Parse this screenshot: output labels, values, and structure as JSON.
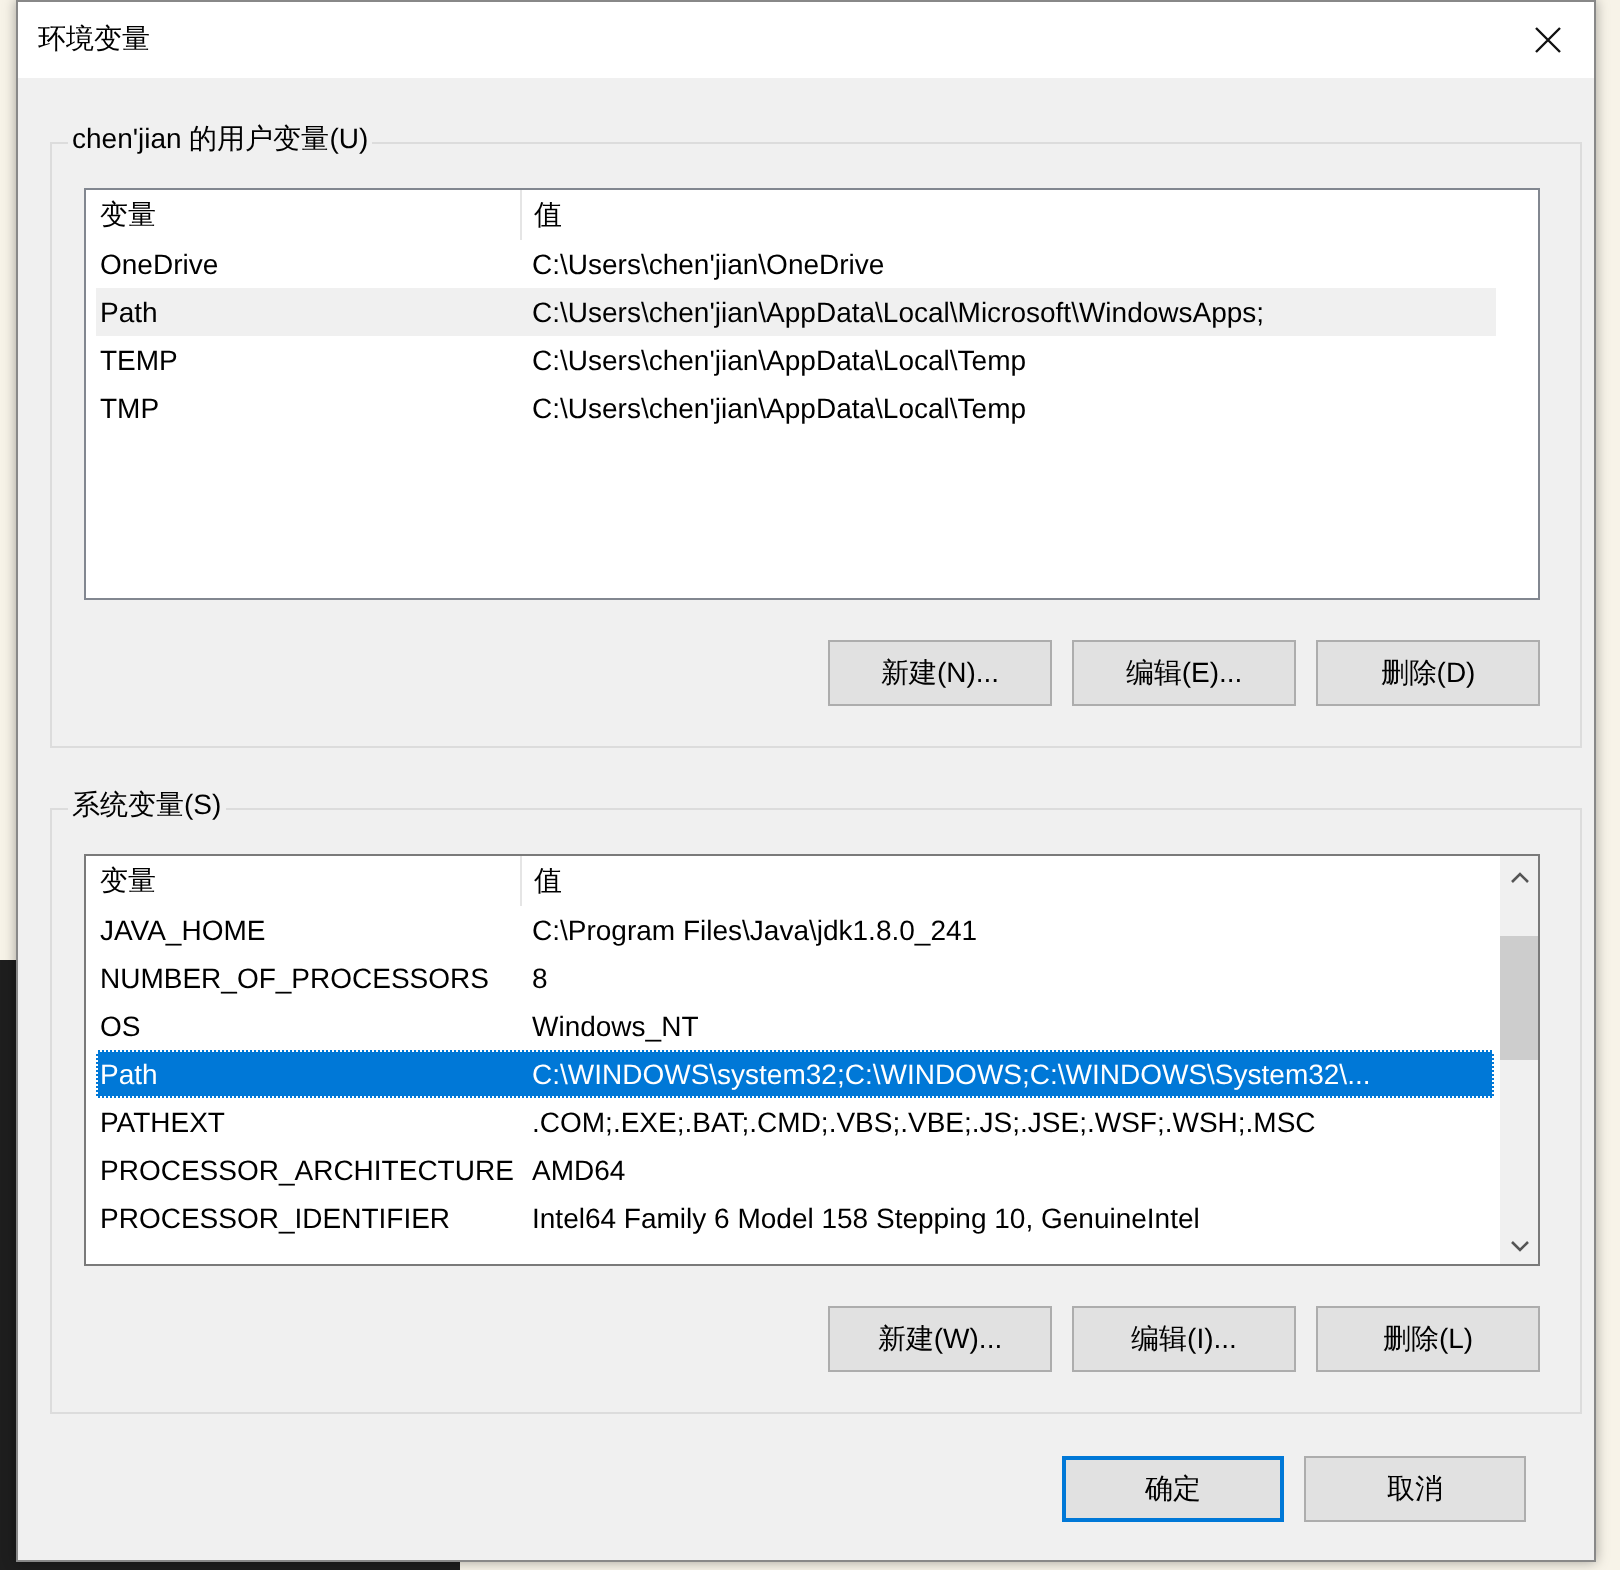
{
  "window": {
    "title": "环境变量"
  },
  "groups": [
    {
      "label": "chen'jian 的用户变量(U)",
      "focused": false,
      "scrollbar": false,
      "columns": [
        "变量",
        "值"
      ],
      "rows": [
        {
          "name": "OneDrive",
          "value": "C:\\Users\\chen'jian\\OneDrive",
          "selected": false
        },
        {
          "name": "Path",
          "value": "C:\\Users\\chen'jian\\AppData\\Local\\Microsoft\\WindowsApps;",
          "selected": true
        },
        {
          "name": "TEMP",
          "value": "C:\\Users\\chen'jian\\AppData\\Local\\Temp",
          "selected": false
        },
        {
          "name": "TMP",
          "value": "C:\\Users\\chen'jian\\AppData\\Local\\Temp",
          "selected": false
        }
      ],
      "buttons": [
        "新建(N)...",
        "编辑(E)...",
        "删除(D)"
      ]
    },
    {
      "label": "系统变量(S)",
      "focused": true,
      "scrollbar": true,
      "columns": [
        "变量",
        "值"
      ],
      "rows": [
        {
          "name": "JAVA_HOME",
          "value": "C:\\Program Files\\Java\\jdk1.8.0_241",
          "selected": false
        },
        {
          "name": "NUMBER_OF_PROCESSORS",
          "value": "8",
          "selected": false
        },
        {
          "name": "OS",
          "value": "Windows_NT",
          "selected": false
        },
        {
          "name": "Path",
          "value": "C:\\WINDOWS\\system32;C:\\WINDOWS;C:\\WINDOWS\\System32\\...",
          "selected": true
        },
        {
          "name": "PATHEXT",
          "value": ".COM;.EXE;.BAT;.CMD;.VBS;.VBE;.JS;.JSE;.WSF;.WSH;.MSC",
          "selected": false
        },
        {
          "name": "PROCESSOR_ARCHITECTURE",
          "value": "AMD64",
          "selected": false
        },
        {
          "name": "PROCESSOR_IDENTIFIER",
          "value": "Intel64 Family 6 Model 158 Stepping 10, GenuineIntel",
          "selected": false
        }
      ],
      "buttons": [
        "新建(W)...",
        "编辑(I)...",
        "删除(L)"
      ]
    }
  ],
  "dialog_buttons": [
    {
      "label": "确定",
      "default": true
    },
    {
      "label": "取消",
      "default": false
    }
  ]
}
